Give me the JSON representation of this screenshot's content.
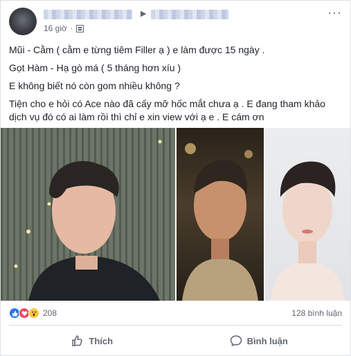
{
  "post": {
    "time": "16 giờ",
    "paragraphs": [
      "Mũi - Cằm ( cằm e từng tiêm Filler ạ ) e làm được 15 ngày .",
      "Gọt Hàm - Hạ gò má ( 5 tháng hơn xíu )",
      "E không biết nó còn gom nhiều không ?",
      "Tiện cho e hỏi có Ace nào đã cấy mỡ hốc mắt chưa ạ . E đang tham khảo",
      "dịch vụ đó có ai làm rồi thì chỉ e xin view với ạ e . E cám ơn"
    ],
    "more_icon": "more-icon",
    "privacy_icon": "globe-icon"
  },
  "reactions": {
    "count": "208",
    "icons": [
      "like-icon",
      "love-icon",
      "wow-icon"
    ]
  },
  "comments": {
    "count_label": "128 bình luận"
  },
  "actions": {
    "like_label": "Thích",
    "comment_label": "Bình luận"
  }
}
